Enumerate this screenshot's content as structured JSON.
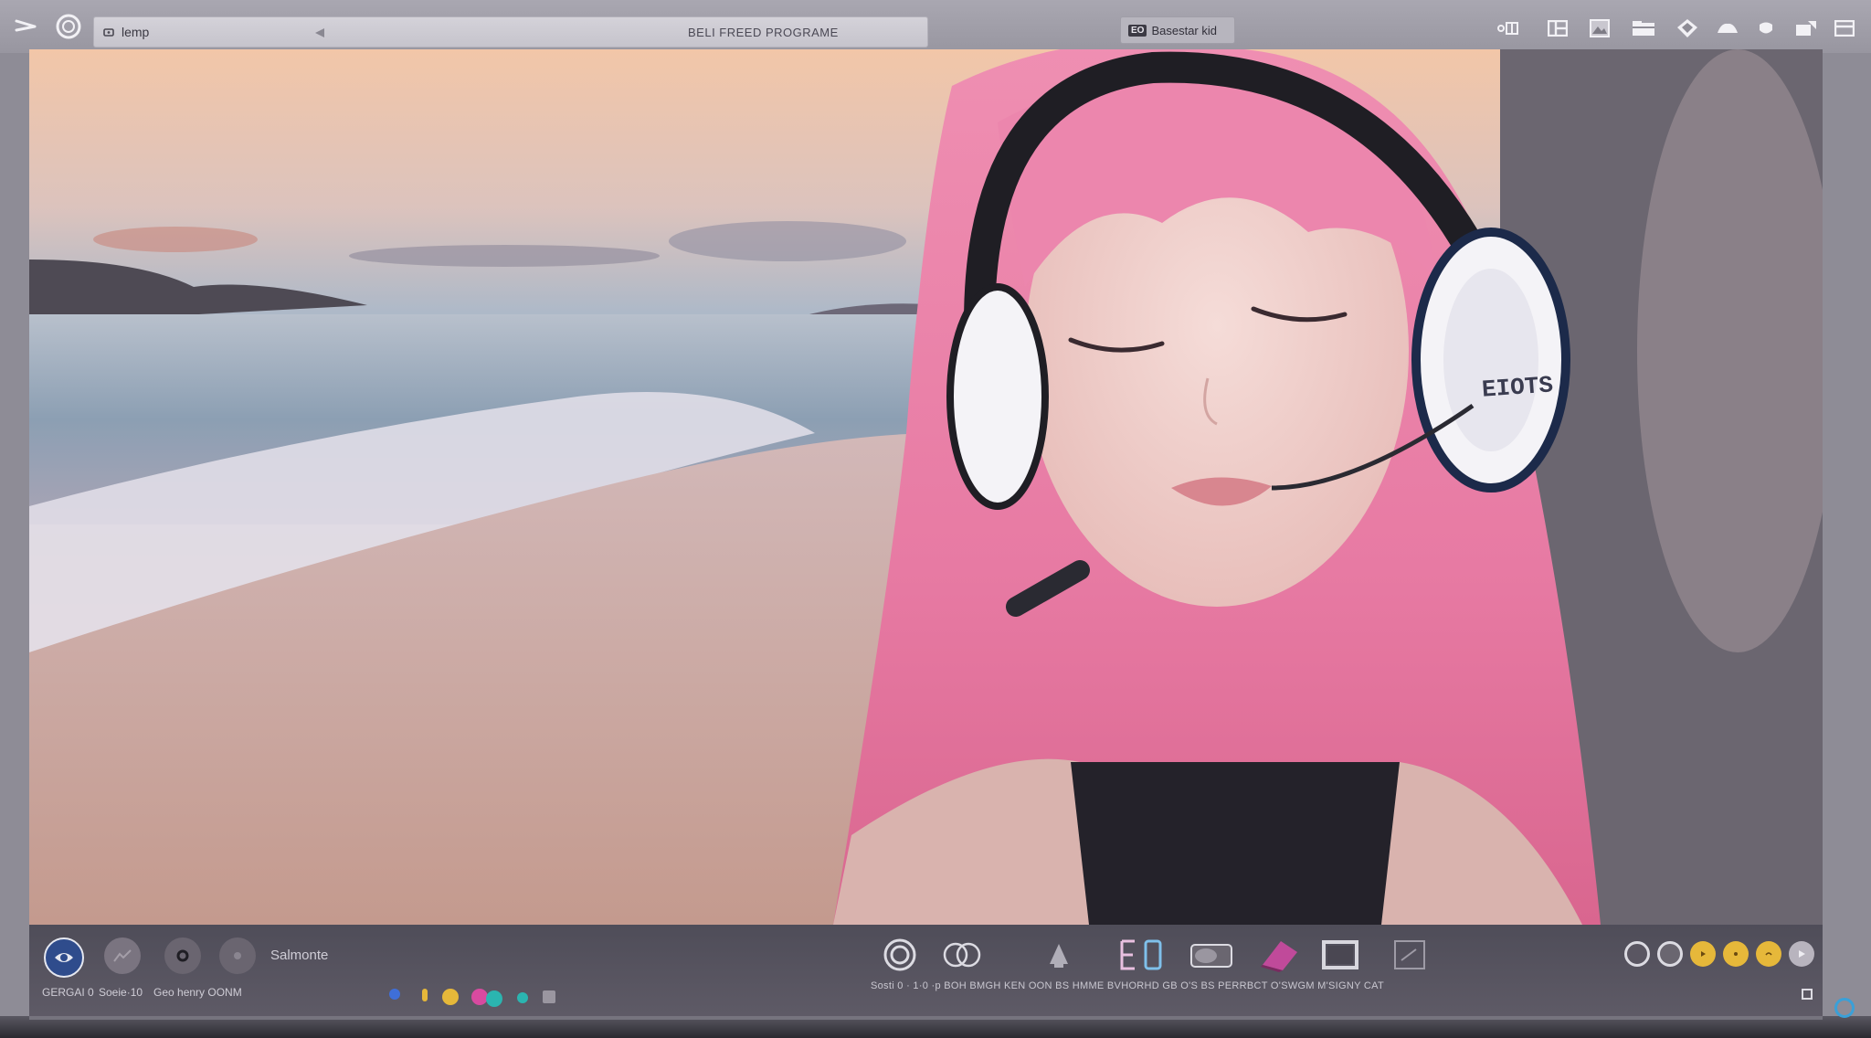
{
  "app": {
    "address_text": "lemp",
    "window_title": "BELI FREED PROGRAME",
    "session_button": {
      "badge": "EO",
      "label": "Basestar kid"
    }
  },
  "toolbar_icons": [
    "menu-icon",
    "circle-icon",
    "slider-icon",
    "layout-icon",
    "image-icon",
    "folder-icon",
    "diamond-icon",
    "cloud-icon",
    "shield-icon",
    "export-icon",
    "window-icon"
  ],
  "viewport": {
    "headphone_label": "EIOTS"
  },
  "bottom": {
    "left_circle_label": "Salmonte",
    "left_caption_1": "GERGAI 0",
    "left_caption_2": "Soeie·10",
    "left_caption_3": "Geo henry OONM",
    "status_text": "Sosti 0 · 1·0 ·p BOH BMGH KEN OON BS HMME BVHORHD GB O'S BS PERRBCT O'SWGM M'SIGNY CAT",
    "colors": {
      "accent_yellow": "#e6b83a",
      "accent_pink": "#d84aa0",
      "accent_teal": "#2bb5b0",
      "accent_blue": "#3f6fd8"
    }
  }
}
